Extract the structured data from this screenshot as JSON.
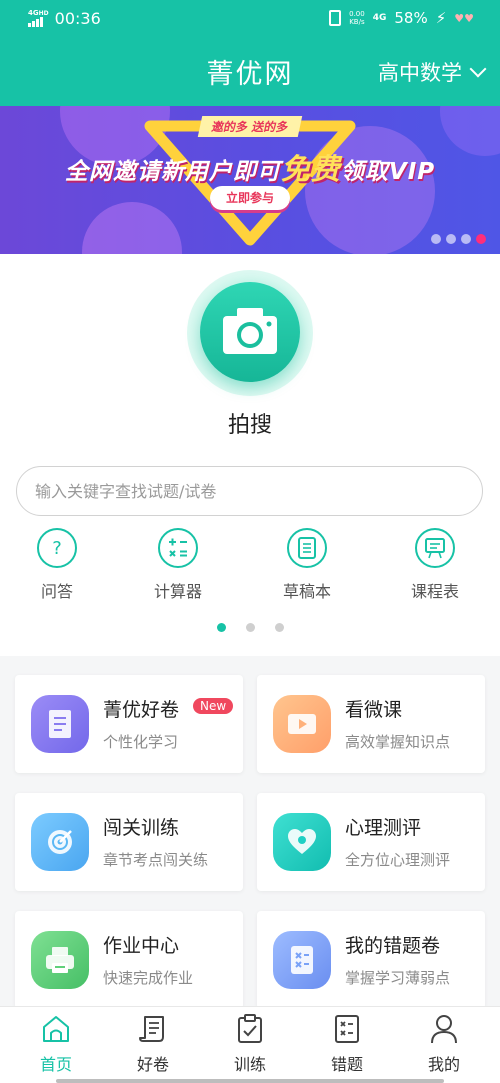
{
  "status_bar": {
    "network_type": "4G",
    "network_hd": "HD",
    "time": "00:36",
    "speed_value": "0.00",
    "speed_unit": "KB/s",
    "data_type": "4G",
    "battery": "58%"
  },
  "header": {
    "title": "菁优网",
    "subject": "高中数学"
  },
  "banner": {
    "tagline": "邀的多 送的多",
    "headline_prefix": "全网邀请新用户即可",
    "headline_highlight": "免费",
    "headline_suffix": "领取VIP",
    "cta": "立即参与",
    "colors": {
      "background": "#5a4ee0",
      "highlight": "#ffe25a",
      "accent": "#e8365a"
    }
  },
  "camera_search": {
    "icon": "camera-icon",
    "label": "拍搜"
  },
  "search": {
    "placeholder": "输入关键字查找试题/试卷"
  },
  "tools": [
    {
      "label": "问答",
      "icon": "question-icon"
    },
    {
      "label": "计算器",
      "icon": "calculator-icon"
    },
    {
      "label": "草稿本",
      "icon": "notebook-icon"
    },
    {
      "label": "课程表",
      "icon": "schedule-board-icon"
    }
  ],
  "features": [
    {
      "title": "菁优好卷",
      "subtitle": "个性化学习",
      "badge": "New",
      "icon": "document-icon",
      "color": "#8a7cf0"
    },
    {
      "title": "看微课",
      "subtitle": "高效掌握知识点",
      "icon": "video-icon",
      "color": "#ffb07a"
    },
    {
      "title": "闯关训练",
      "subtitle": "章节考点闯关练",
      "icon": "target-icon",
      "color": "#5ab8f5"
    },
    {
      "title": "心理测评",
      "subtitle": "全方位心理测评",
      "icon": "heart-icon",
      "color": "#1fd0c4"
    },
    {
      "title": "作业中心",
      "subtitle": "快速完成作业",
      "icon": "printer-icon",
      "color": "#5fd07a"
    },
    {
      "title": "我的错题卷",
      "subtitle": "掌握学习薄弱点",
      "icon": "error-book-icon",
      "color": "#7aa2f7"
    }
  ],
  "bottom_nav": [
    {
      "label": "首页",
      "icon": "home-icon",
      "active": true
    },
    {
      "label": "好卷",
      "icon": "scroll-icon"
    },
    {
      "label": "训练",
      "icon": "clipboard-check-icon"
    },
    {
      "label": "错题",
      "icon": "error-book-icon"
    },
    {
      "label": "我的",
      "icon": "user-icon"
    }
  ],
  "colors": {
    "brand": "#17c2a6",
    "badge": "#f0485e"
  }
}
